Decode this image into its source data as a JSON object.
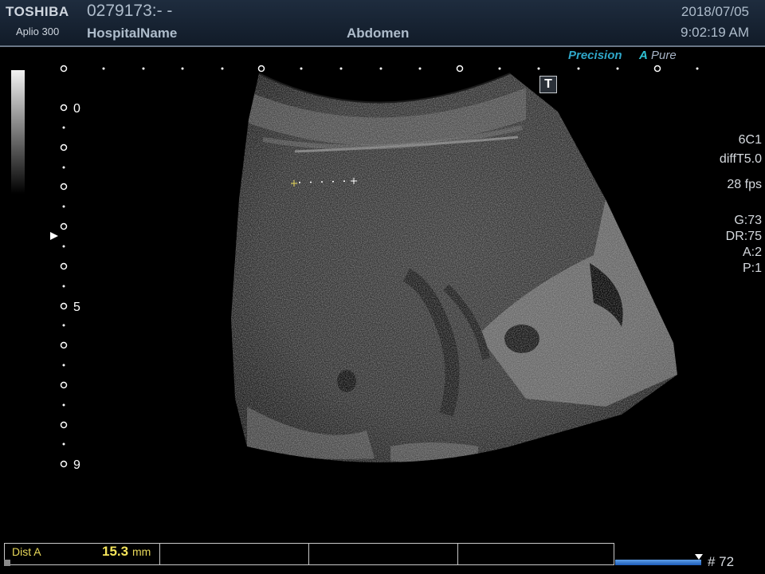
{
  "header": {
    "brand": "TOSHIBA",
    "model": "Aplio 300",
    "patient_id": "0279173:- -",
    "hospital": "HospitalName",
    "exam": "Abdomen",
    "date": "2018/07/05",
    "time": "9:02:19 AM"
  },
  "logo": {
    "precision": "Precision",
    "a": "A",
    "pure": "Pure"
  },
  "t_icon": "T",
  "depth_scale": {
    "labels": [
      "0",
      "5",
      "9"
    ]
  },
  "params": {
    "probe": "6C1",
    "mode": "diffT5.0",
    "fps": "28 fps",
    "gain": "G:73",
    "dynamic_range": "DR:75",
    "a": "A:2",
    "p": "P:1"
  },
  "measurement": {
    "label": "Dist A",
    "value": "15.3",
    "unit": "mm"
  },
  "cine": {
    "frame_count": "# 72"
  },
  "colors": {
    "header_bg": "#1e2c3e",
    "text": "#aebccb",
    "measure": "#f3e35a",
    "cine": "#3a7fd8"
  }
}
